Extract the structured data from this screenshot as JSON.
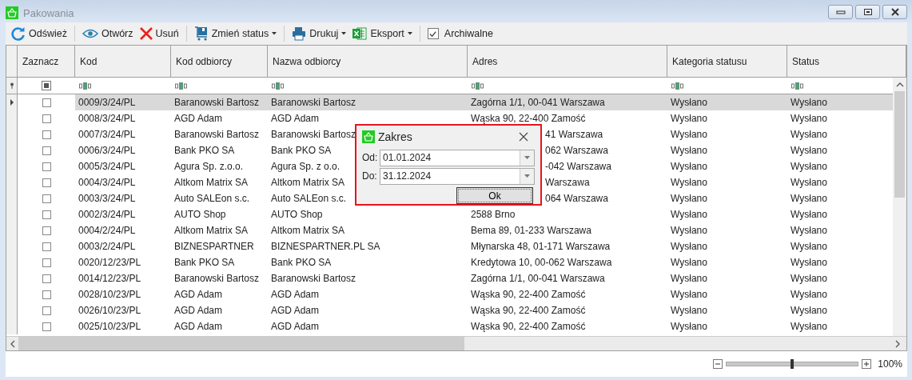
{
  "window": {
    "title": "Pakowania"
  },
  "toolbar": [
    {
      "kind": "button",
      "label": "Odśwież"
    },
    {
      "kind": "button",
      "label": "Otwórz"
    },
    {
      "kind": "button",
      "label": "Usuń"
    },
    {
      "kind": "dropdown",
      "label": "Zmień status"
    },
    {
      "kind": "dropdown",
      "label": "Drukuj"
    },
    {
      "kind": "dropdown",
      "label": "Eksport"
    },
    {
      "kind": "checkbox",
      "label": "Archiwalne",
      "checked": true
    }
  ],
  "table": {
    "columns": [
      "Zaznacz",
      "Kod",
      "Kod odbiorcy",
      "Nazwa odbiorcy",
      "Adres",
      "Kategoria statusu",
      "Status"
    ],
    "select_all": {
      "indeterminate": true
    },
    "rows": [
      {
        "selected": true,
        "checked": false,
        "kod": "0009/3/24/PL",
        "kod_odbiorcy": "Baranowski Bartosz",
        "nazwa": "Baranowski Bartosz",
        "adres": "Zagórna 1/1, 00-041 Warszawa",
        "kategoria": "Wysłano",
        "status": "Wysłano"
      },
      {
        "selected": false,
        "checked": false,
        "kod": "0008/3/24/PL",
        "kod_odbiorcy": "AGD Adam",
        "nazwa": "AGD Adam",
        "adres": "Wąska 90, 22-400 Zamość",
        "kategoria": "Wysłano",
        "status": "Wysłano"
      },
      {
        "selected": false,
        "checked": false,
        "kod": "0007/3/24/PL",
        "kod_odbiorcy": "Baranowski Bartosz",
        "nazwa": "Baranowski Bartosz",
        "adres": "41 Warszawa",
        "adres_partial": true,
        "kategoria": "Wysłano",
        "status": "Wysłano"
      },
      {
        "selected": false,
        "checked": false,
        "kod": "0006/3/24/PL",
        "kod_odbiorcy": "Bank PKO SA",
        "nazwa": "Bank PKO SA",
        "adres": "062 Warszawa",
        "adres_partial": true,
        "kategoria": "Wysłano",
        "status": "Wysłano"
      },
      {
        "selected": false,
        "checked": false,
        "kod": "0005/3/24/PL",
        "kod_odbiorcy": "Agura Sp. z.o.o.",
        "nazwa": "Agura Sp. z o.o.",
        "adres": "-042 Warszawa",
        "adres_partial": true,
        "kategoria": "Wysłano",
        "status": "Wysłano"
      },
      {
        "selected": false,
        "checked": false,
        "kod": "0004/3/24/PL",
        "kod_odbiorcy": "Altkom Matrix SA",
        "nazwa": "Altkom Matrix SA",
        "adres": "Warszawa",
        "adres_partial": true,
        "kategoria": "Wysłano",
        "status": "Wysłano"
      },
      {
        "selected": false,
        "checked": false,
        "kod": "0003/3/24/PL",
        "kod_odbiorcy": "Auto SALEon s.c.",
        "nazwa": "Auto SALEon s.c.",
        "adres": "064 Warszawa",
        "adres_partial": true,
        "kategoria": "Wysłano",
        "status": "Wysłano"
      },
      {
        "selected": false,
        "checked": false,
        "kod": "0002/3/24/PL",
        "kod_odbiorcy": "AUTO Shop",
        "nazwa": "AUTO Shop",
        "adres": "2588 Brno",
        "kategoria": "Wysłano",
        "status": "Wysłano"
      },
      {
        "selected": false,
        "checked": false,
        "kod": "0004/2/24/PL",
        "kod_odbiorcy": "Altkom Matrix SA",
        "nazwa": "Altkom Matrix SA",
        "adres": "Bema 89, 01-233 Warszawa",
        "kategoria": "Wysłano",
        "status": "Wysłano"
      },
      {
        "selected": false,
        "checked": false,
        "kod": "0003/2/24/PL",
        "kod_odbiorcy": "BIZNESPARTNER",
        "nazwa": "BIZNESPARTNER.PL SA",
        "adres": "Młynarska 48, 01-171 Warszawa",
        "kategoria": "Wysłano",
        "status": "Wysłano"
      },
      {
        "selected": false,
        "checked": false,
        "kod": "0020/12/23/PL",
        "kod_odbiorcy": "Bank PKO SA",
        "nazwa": "Bank PKO SA",
        "adres": "Kredytowa 10, 00-062 Warszawa",
        "kategoria": "Wysłano",
        "status": "Wysłano"
      },
      {
        "selected": false,
        "checked": false,
        "kod": "0014/12/23/PL",
        "kod_odbiorcy": "Baranowski Bartosz",
        "nazwa": "Baranowski Bartosz",
        "adres": "Zagórna 1/1, 00-041 Warszawa",
        "kategoria": "Wysłano",
        "status": "Wysłano"
      },
      {
        "selected": false,
        "checked": false,
        "kod": "0028/10/23/PL",
        "kod_odbiorcy": "AGD Adam",
        "nazwa": "AGD Adam",
        "adres": "Wąska 90, 22-400 Zamość",
        "kategoria": "Wysłano",
        "status": "Wysłano"
      },
      {
        "selected": false,
        "checked": false,
        "kod": "0026/10/23/PL",
        "kod_odbiorcy": "AGD Adam",
        "nazwa": "AGD Adam",
        "adres": "Wąska 90, 22-400 Zamość",
        "kategoria": "Wysłano",
        "status": "Wysłano"
      },
      {
        "selected": false,
        "checked": false,
        "kod": "0025/10/23/PL",
        "kod_odbiorcy": "AGD Adam",
        "nazwa": "AGD Adam",
        "adres": "Wąska 90, 22-400 Zamość",
        "kategoria": "Wysłano",
        "status": "Wysłano"
      }
    ]
  },
  "dialog": {
    "title": "Zakres",
    "fields": [
      {
        "label": "Od:",
        "value": "01.01.2024"
      },
      {
        "label": "Do:",
        "value": "31.12.2024"
      }
    ],
    "button": "Ok"
  },
  "zoom": {
    "level": 0.5,
    "reading": "100%"
  }
}
